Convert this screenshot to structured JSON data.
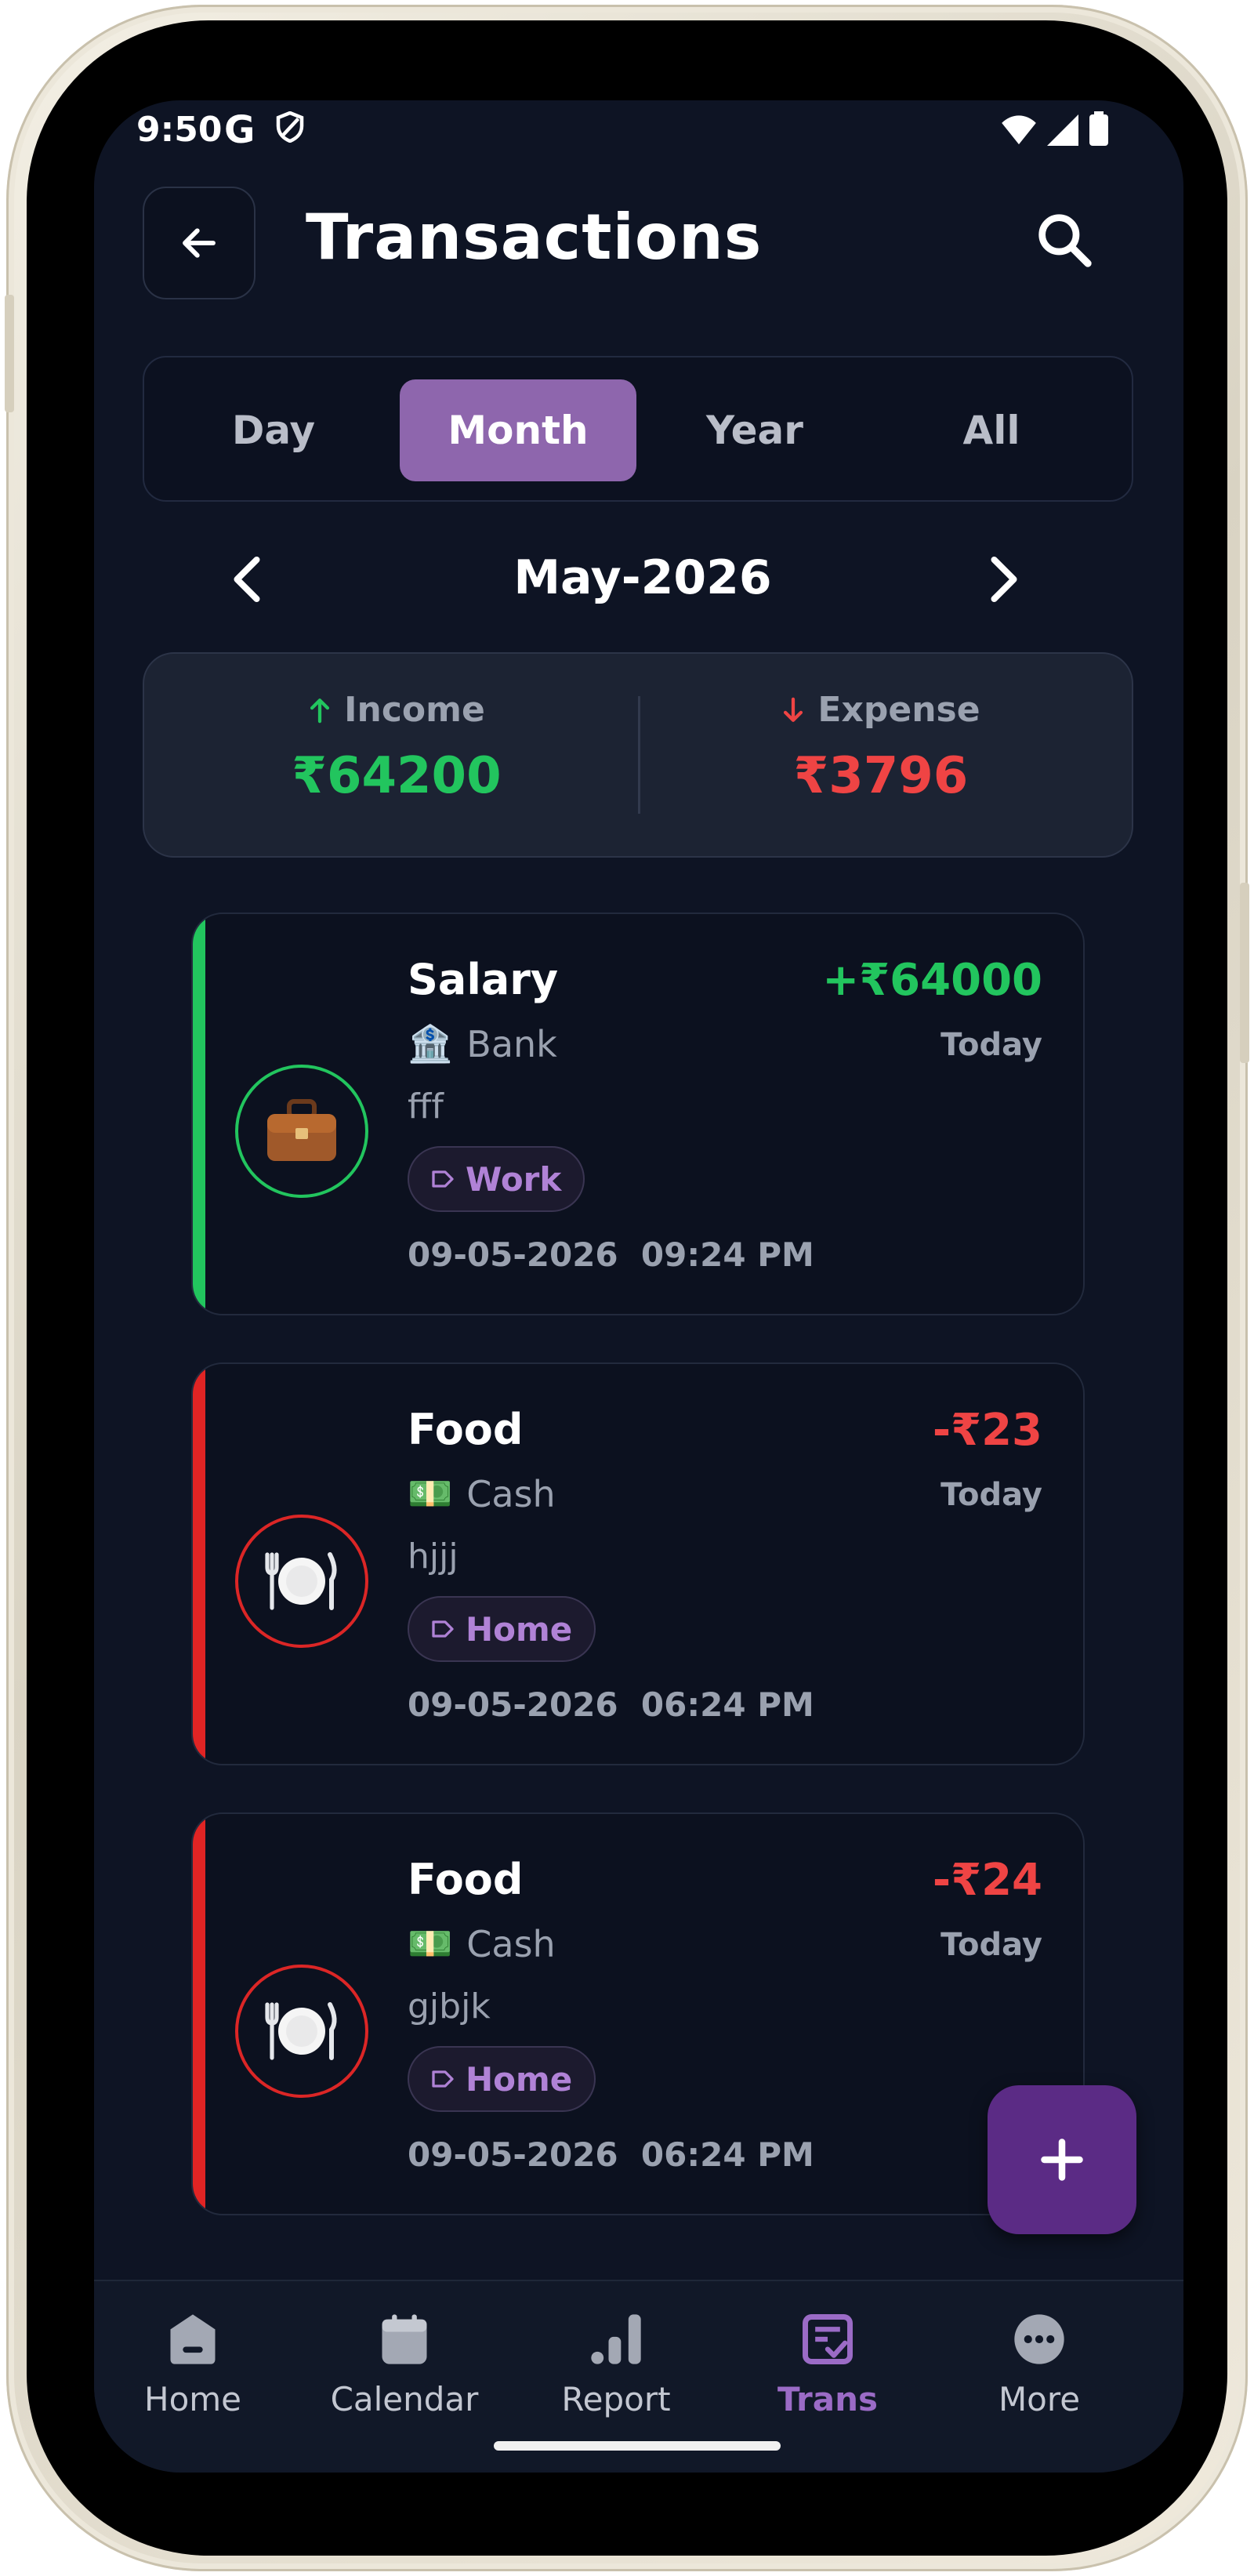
{
  "status_bar": {
    "time": "9:50",
    "g_label": "G"
  },
  "header": {
    "title": "Transactions"
  },
  "tabs": [
    {
      "label": "Day"
    },
    {
      "label": "Month",
      "active": true
    },
    {
      "label": "Year"
    },
    {
      "label": "All"
    }
  ],
  "period": {
    "label": "May-2026"
  },
  "summary": {
    "income_label": "Income",
    "income_value": "₹64200",
    "expense_label": "Expense",
    "expense_value": "₹3796"
  },
  "transactions": [
    {
      "category": "Salary",
      "amount": "+₹64000",
      "type": "income",
      "account": "Bank",
      "account_icon": "🏦",
      "when": "Today",
      "note": "fff",
      "tag": "Work",
      "datetime": "09-05-2026  09:24 PM",
      "icon": "briefcase"
    },
    {
      "category": "Food",
      "amount": "-₹23",
      "type": "expense",
      "account": "Cash",
      "account_icon": "💵",
      "when": "Today",
      "note": "hjjj",
      "tag": "Home",
      "datetime": "09-05-2026  06:24 PM",
      "icon": "plate"
    },
    {
      "category": "Food",
      "amount": "-₹24",
      "type": "expense",
      "account": "Cash",
      "account_icon": "💵",
      "when": "Today",
      "note": "gjbjk",
      "tag": "Home",
      "datetime": "09-05-2026  06:24 PM",
      "icon": "plate"
    }
  ],
  "nav": [
    {
      "label": "Home",
      "icon": "home-icon"
    },
    {
      "label": "Calendar",
      "icon": "calendar-icon"
    },
    {
      "label": "Report",
      "icon": "bar-chart-icon"
    },
    {
      "label": "Trans",
      "icon": "transactions-icon",
      "active": true
    },
    {
      "label": "More",
      "icon": "more-icon"
    }
  ],
  "colors": {
    "background": "#0e1424",
    "accent": "#8e66ad",
    "income": "#22c55e",
    "expense": "#ef4444",
    "fab": "#5b2b85"
  }
}
